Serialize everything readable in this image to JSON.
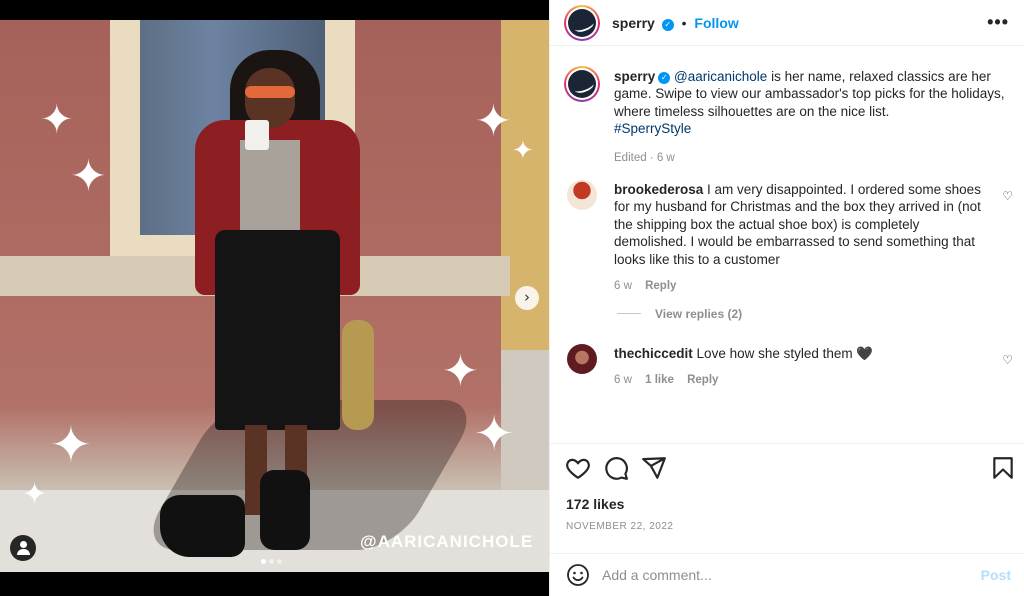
{
  "media": {
    "watermark": "@AARICANICHOLE",
    "carousel": {
      "slides": 3,
      "active": 1
    },
    "next_icon": "chevron-right-icon",
    "tag_icon": "user-tag-icon"
  },
  "header": {
    "username": "sperry",
    "separator": "•",
    "follow_label": "Follow",
    "more_label": "•••"
  },
  "caption": {
    "username": "sperry",
    "mention": "@aaricanichole",
    "text": " is her name, relaxed classics are her game. Swipe to view our ambassador's top picks for the holidays, where timeless silhouettes are on the nice list.",
    "hashtag": "#SperryStyle",
    "meta": "Edited · 6 w"
  },
  "comments": [
    {
      "username": "brookederosa",
      "text": "I am very disappointed. I ordered some shoes for my husband for Christmas and the box they arrived in (not the shipping box the actual shoe box) is completely demolished. I would be embarrassed to send something that looks like this to a customer",
      "time": "6 w",
      "reply_label": "Reply",
      "view_replies": "View replies (2)"
    },
    {
      "username": "thechiccedit",
      "text": "Love how she styled them 🖤",
      "time": "6 w",
      "likes": "1 like",
      "reply_label": "Reply"
    }
  ],
  "actions": {
    "likes": "172 likes",
    "date": "NOVEMBER 22, 2022",
    "icons": [
      "heart-icon",
      "comment-icon",
      "share-icon",
      "bookmark-icon"
    ]
  },
  "add_comment": {
    "placeholder": "Add a comment...",
    "post_label": "Post"
  },
  "colors": {
    "accent": "#0095f6",
    "link": "#00376b",
    "muted": "#8e8e8e",
    "post_disabled": "#b2dffc"
  }
}
